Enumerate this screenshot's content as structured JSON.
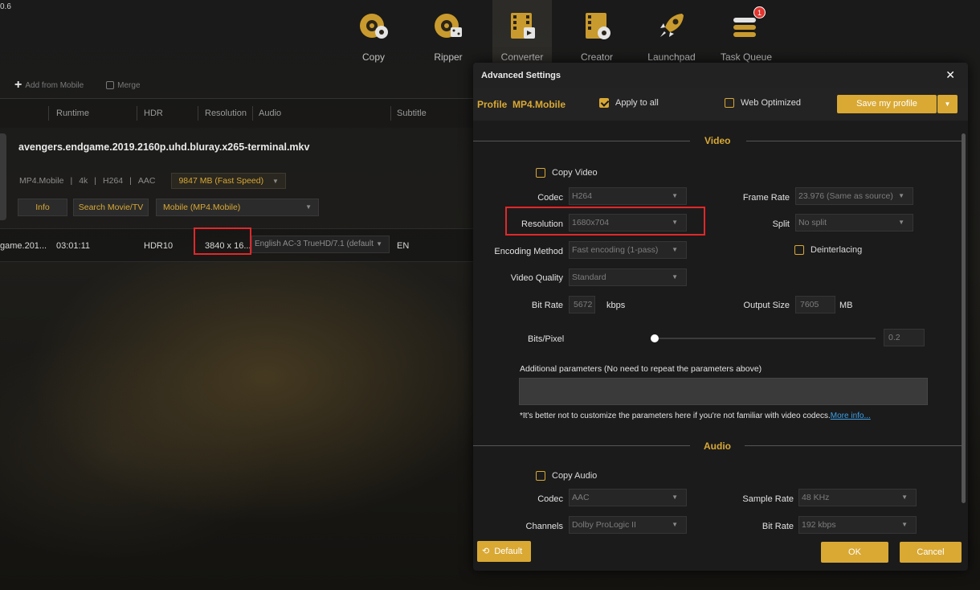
{
  "app": {
    "version": "0.6"
  },
  "nav": [
    {
      "label": "Copy",
      "icon": "copy-disc-icon"
    },
    {
      "label": "Ripper",
      "icon": "ripper-disc-icon"
    },
    {
      "label": "Converter",
      "icon": "converter-film-icon",
      "active": true
    },
    {
      "label": "Creator",
      "icon": "creator-film-icon"
    },
    {
      "label": "Launchpad",
      "icon": "rocket-icon"
    },
    {
      "label": "Task Queue",
      "icon": "task-queue-icon",
      "badge": "1"
    }
  ],
  "toolbar": {
    "add_from_mobile": "Add from Mobile",
    "merge": "Merge"
  },
  "columns": [
    "Runtime",
    "HDR",
    "Resolution",
    "Audio",
    "Subtitle"
  ],
  "file": {
    "title": "avengers.endgame.2019.2160p.uhd.bluray.x265-terminal.mkv",
    "meta": [
      "MP4.Mobile",
      "4k",
      "H264",
      "AAC"
    ],
    "size": "9847 MB (Fast Speed)",
    "info_btn": "Info",
    "search_btn": "Search Movie/TV",
    "profile": "Mobile (MP4.Mobile)"
  },
  "track": {
    "name": "game.201...",
    "runtime": "03:01:11",
    "hdr": "HDR10",
    "resolution": "3840 x 16...",
    "audio": "English AC-3 TrueHD/7.1 (default)",
    "subtitle": "EN"
  },
  "dialog": {
    "title": "Advanced Settings",
    "profile_label": "Profile",
    "profile_name": "MP4.Mobile",
    "apply_all": "Apply to all",
    "web_optimized": "Web Optimized",
    "save_profile": "Save my profile",
    "video": {
      "section": "Video",
      "copy_video": "Copy Video",
      "codec_label": "Codec",
      "codec": "H264",
      "frame_rate_label": "Frame Rate",
      "frame_rate": "23.976 (Same as source)",
      "resolution_label": "Resolution",
      "resolution": "1680x704",
      "split_label": "Split",
      "split": "No split",
      "encoding_label": "Encoding Method",
      "encoding": "Fast encoding (1-pass)",
      "deinterlacing": "Deinterlacing",
      "quality_label": "Video Quality",
      "quality": "Standard",
      "bitrate_label": "Bit Rate",
      "bitrate": "5672",
      "bitrate_unit": "kbps",
      "output_size_label": "Output Size",
      "output_size": "7605",
      "output_size_unit": "MB",
      "bits_pixel_label": "Bits/Pixel",
      "bits_pixel": "0.2",
      "additional_label": "Additional parameters (No need to repeat the parameters above)",
      "note": "*It's better not to customize the parameters here if you're not familiar with video codecs.",
      "more_info": "More info..."
    },
    "audio": {
      "section": "Audio",
      "copy_audio": "Copy Audio",
      "codec_label": "Codec",
      "codec": "AAC",
      "sample_rate_label": "Sample Rate",
      "sample_rate": "48 KHz",
      "channels_label": "Channels",
      "channels": "Dolby ProLogic II",
      "bitrate_label": "Bit Rate",
      "bitrate": "192 kbps"
    },
    "default_btn": "Default",
    "ok_btn": "OK",
    "cancel_btn": "Cancel"
  },
  "colors": {
    "accent": "#d9a934",
    "highlight": "#e0282a",
    "badge": "#e1342e"
  }
}
